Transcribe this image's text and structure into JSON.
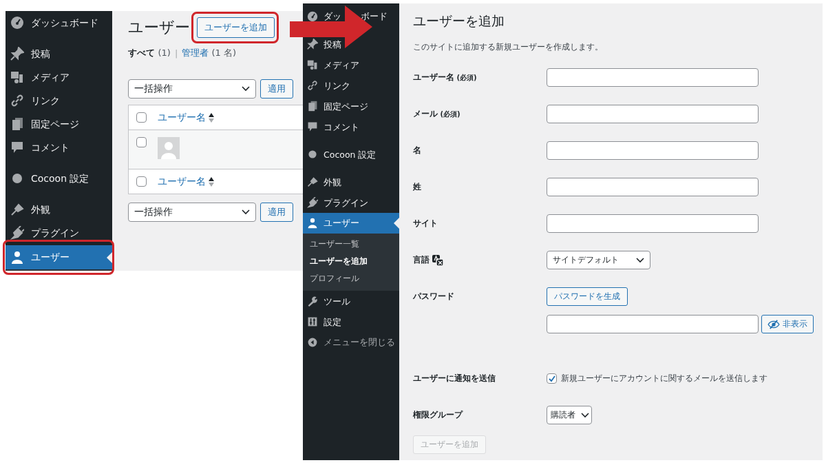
{
  "left_screenshot": {
    "sidebar": {
      "groups": [
        {
          "items": [
            {
              "label": "ダッシュボード",
              "selected": false
            }
          ]
        },
        {
          "items": [
            {
              "label": "投稿",
              "selected": false
            },
            {
              "label": "メディア",
              "selected": false
            },
            {
              "label": "リンク",
              "selected": false
            },
            {
              "label": "固定ページ",
              "selected": false
            },
            {
              "label": "コメント",
              "selected": false
            }
          ]
        },
        {
          "items": [
            {
              "label": "Cocoon 設定",
              "selected": false
            }
          ]
        },
        {
          "items": [
            {
              "label": "外観",
              "selected": false
            },
            {
              "label": "プラグイン",
              "selected": false
            },
            {
              "label": "ユーザー",
              "selected": true
            }
          ]
        }
      ]
    },
    "page_title": "ユーザー",
    "add_button": "ユーザーを追加",
    "filters": [
      {
        "label": "すべて",
        "count": "(1)",
        "selected": true
      },
      {
        "label": "管理者",
        "count": "(1 名)",
        "selected": false
      }
    ],
    "filter_separator": "|",
    "bulk_top": {
      "value": "一括操作",
      "apply": "適用"
    },
    "table": {
      "header": {
        "checked": false,
        "column": "ユーザー名"
      },
      "rows": [
        {
          "checked": false
        }
      ],
      "footer": {
        "checked": false,
        "column": "ユーザー名"
      }
    },
    "bulk_bottom": {
      "value": "一括操作",
      "apply": "適用"
    }
  },
  "right_screenshot": {
    "sidebar": {
      "groups": [
        {
          "items": [
            {
              "label": "ダッ",
              "label_after_arrow": "ボード",
              "selected": false
            }
          ]
        },
        {
          "items": [
            {
              "label": "投稿",
              "selected": false
            },
            {
              "label": "メディア",
              "selected": false
            },
            {
              "label": "リンク",
              "selected": false
            },
            {
              "label": "固定ページ",
              "selected": false
            },
            {
              "label": "コメント",
              "selected": false
            }
          ]
        },
        {
          "items": [
            {
              "label": "Cocoon 設定",
              "selected": false
            }
          ]
        },
        {
          "items": [
            {
              "label": "外観",
              "selected": false
            },
            {
              "label": "プラグイン",
              "selected": false
            },
            {
              "label": "ユーザー",
              "selected": true,
              "children": [
                {
                  "label": "ユーザー一覧",
                  "selected": false
                },
                {
                  "label": "ユーザーを追加",
                  "selected": true
                },
                {
                  "label": "プロフィール",
                  "selected": false
                }
              ]
            },
            {
              "label": "ツール",
              "selected": false
            },
            {
              "label": "設定",
              "selected": false
            }
          ]
        }
      ],
      "collapse": "メニューを閉じる"
    },
    "page_title": "ユーザーを追加",
    "description": "このサイトに追加する新規ユーザーを作成します。",
    "fields": [
      {
        "kind": "text",
        "label": "ユーザー名",
        "note": "(必須)"
      },
      {
        "kind": "text",
        "label": "メール",
        "note": "(必須)"
      },
      {
        "kind": "text",
        "label": "名"
      },
      {
        "kind": "text",
        "label": "姓"
      },
      {
        "kind": "text",
        "label": "サイト"
      },
      {
        "kind": "language",
        "label": "言語",
        "value": "サイトデフォルト"
      },
      {
        "kind": "password",
        "label": "パスワード",
        "generate": "パスワードを生成",
        "toggle": "非表示"
      },
      {
        "kind": "checkbox",
        "label": "ユーザーに通知を送信",
        "text": "新規ユーザーにアカウントに関するメールを送信します",
        "checked": true
      },
      {
        "kind": "select",
        "label": "権限グループ",
        "value": "購読者"
      }
    ],
    "submit": {
      "label": "ユーザーを追加",
      "disabled": true
    }
  }
}
